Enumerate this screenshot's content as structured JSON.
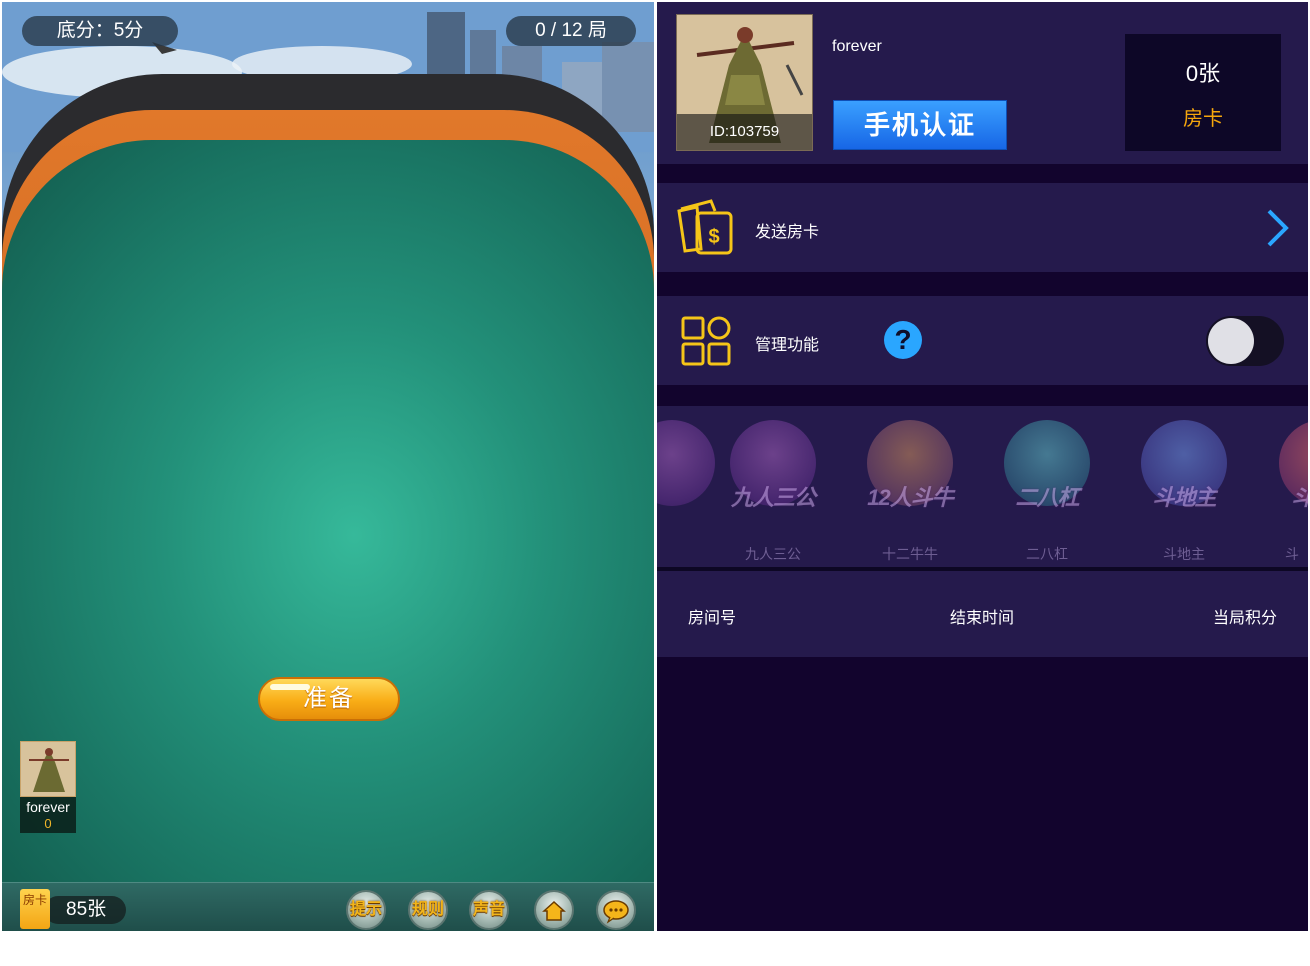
{
  "game": {
    "base_score": "底分：5分",
    "round_count": "0 / 12 局",
    "ready_button": "准备",
    "player": {
      "name": "forever",
      "score": "0"
    },
    "room_card": {
      "icon_text": "房卡",
      "count": "85张"
    },
    "bottom_buttons": [
      {
        "label": "提示"
      },
      {
        "label": "规则"
      },
      {
        "label": "声音"
      },
      {
        "label": "",
        "icon": "home-icon"
      },
      {
        "label": "",
        "icon": "chat-icon"
      }
    ]
  },
  "panel": {
    "profile": {
      "name": "forever",
      "id": "ID:103759",
      "phone_button": "手机认证"
    },
    "card_box": {
      "count": "0张",
      "label": "房卡"
    },
    "send_card": {
      "label": "发送房卡",
      "icon": "card-dollar-icon"
    },
    "manage": {
      "label": "管理功能",
      "help": "?",
      "toggle_on": false
    },
    "games": [
      {
        "logo": "",
        "name": ""
      },
      {
        "logo": "九人三公",
        "name": "九人三公"
      },
      {
        "logo": "12人斗牛",
        "name": "十二牛牛"
      },
      {
        "logo": "二八杠",
        "name": "二八杠"
      },
      {
        "logo": "斗地主",
        "name": "斗地主"
      },
      {
        "logo": "斗",
        "name": "斗"
      }
    ],
    "table_headers": {
      "room": "房间号",
      "end_time": "结束时间",
      "score": "当局积分"
    }
  },
  "colors": {
    "felt": "#23917a",
    "panel_bg": "#12042d",
    "row_bg": "#251a4c",
    "accent_orange": "#f5a60d",
    "accent_blue": "#2aa6ff"
  }
}
